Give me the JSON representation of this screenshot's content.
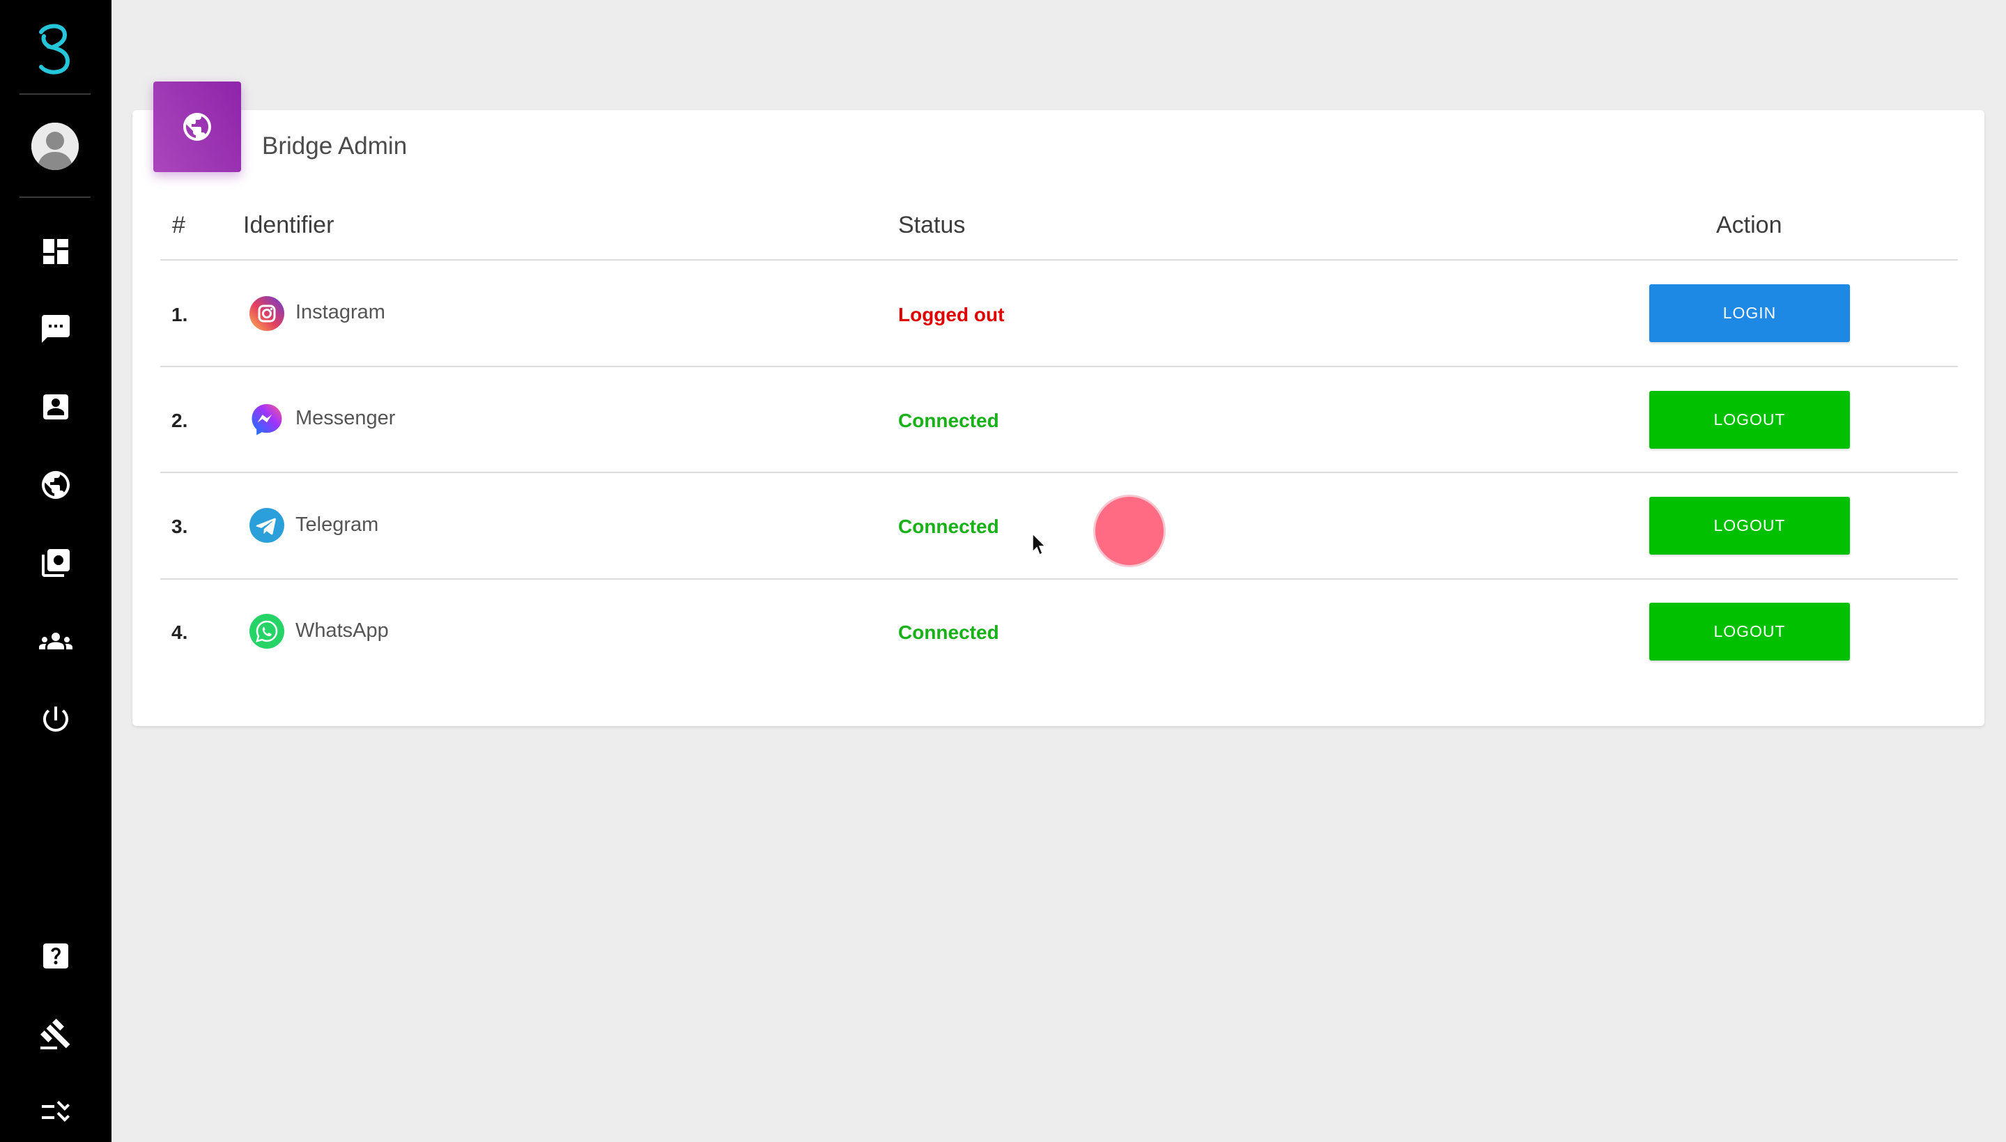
{
  "app": {
    "logo_icon": "beeper-logo-icon",
    "accent_color": "#26c6da"
  },
  "sidebar": {
    "avatar": "user-avatar",
    "items": [
      {
        "icon": "dashboard-icon"
      },
      {
        "icon": "chat-icon"
      },
      {
        "icon": "contacts-icon"
      },
      {
        "icon": "globe-icon"
      },
      {
        "icon": "media-icon"
      },
      {
        "icon": "groups-icon"
      },
      {
        "icon": "power-icon"
      },
      {
        "icon": "help-icon"
      },
      {
        "icon": "gavel-icon"
      },
      {
        "icon": "checklist-icon"
      }
    ]
  },
  "card": {
    "title": "Bridge Admin",
    "badge_icon": "globe-icon",
    "badge_color": "#9c27b0",
    "columns": {
      "num": "#",
      "identifier": "Identifier",
      "status": "Status",
      "action": "Action"
    },
    "rows": [
      {
        "num": "1.",
        "name": "Instagram",
        "icon": "instagram-icon",
        "status": "Logged out",
        "action": "LOGIN"
      },
      {
        "num": "2.",
        "name": "Messenger",
        "icon": "messenger-icon",
        "status": "Connected",
        "action": "LOGOUT"
      },
      {
        "num": "3.",
        "name": "Telegram",
        "icon": "telegram-icon",
        "status": "Connected",
        "action": "LOGOUT"
      },
      {
        "num": "4.",
        "name": "WhatsApp",
        "icon": "whatsapp-icon",
        "status": "Connected",
        "action": "LOGOUT"
      }
    ]
  },
  "colors": {
    "logged_out": "#e00000",
    "connected": "#17b217",
    "login_button": "#1e88e5",
    "logout_button": "#00c000"
  }
}
